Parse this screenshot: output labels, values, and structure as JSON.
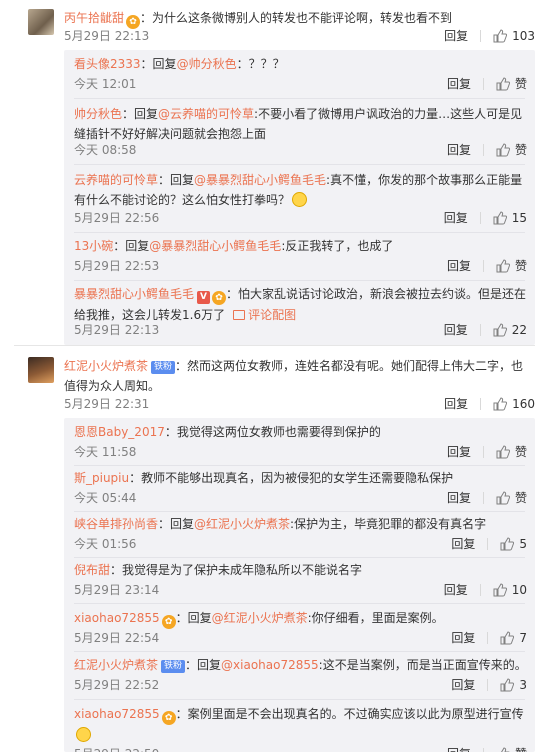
{
  "threads": [
    {
      "author": "丙午拾龇甜",
      "text": "：为什么这条微博别人的转发也不能评论啊，转发也看不到",
      "time": "5月29日 22:13",
      "reply": "回复",
      "likes": "103",
      "replies": [
        {
          "author": "看头像2333",
          "text": "：回复",
          "mention": "@帅分秋色",
          "rest": "：？？？",
          "time": "今天 12:01",
          "reply": "回复",
          "likes": "赞"
        },
        {
          "author": "帅分秋色",
          "text": "：回复",
          "mention": "@云养喵的可怜草",
          "rest": ":不要小看了微博用户讽政治的力量…这些人可是见缝插针不好好解决问题就会抱怨上面",
          "time": "今天 08:58",
          "reply": "回复",
          "likes": "赞"
        },
        {
          "author": "云养喵的可怜草",
          "text": "：回复",
          "mention": "@暴暴烈甜心小鳄鱼毛毛",
          "rest": ":真不懂，你发的那个故事那么正能量有什么不能讨论的？这么怕女性打拳吗？",
          "time": "5月29日 22:56",
          "reply": "回复",
          "likes": "15"
        },
        {
          "author": "13小碗",
          "text": "：回复",
          "mention": "@暴暴烈甜心小鳄鱼毛毛",
          "rest": ":反正我转了，也成了",
          "time": "5月29日 22:53",
          "reply": "回复",
          "likes": "赞"
        },
        {
          "author": "暴暴烈甜心小鳄鱼毛毛",
          "text": "：怕大家乱说话讨论政治，新浪会被拉去约谈。但是还在给我推，这会儿转发1.6万了",
          "pic_link": "评论配图",
          "time": "5月29日 22:13",
          "reply": "回复",
          "likes": "22"
        }
      ]
    },
    {
      "author": "红泥小火炉煮茶",
      "badge": "铁粉",
      "text": "：然而这两位女教师，连姓名都没有呢。她们配得上伟大二字，也值得为众人周知。",
      "time": "5月29日 22:31",
      "reply": "回复",
      "likes": "160",
      "replies": [
        {
          "author": "恩恩Baby_2017",
          "text": "：我觉得这两位女教师也需要得到保护的",
          "time": "今天 11:58",
          "reply": "回复",
          "likes": "赞"
        },
        {
          "author": "斯_piupiu",
          "text": "：教师不能够出现真名，因为被侵犯的女学生还需要隐私保护",
          "time": "今天 05:44",
          "reply": "回复",
          "likes": "赞"
        },
        {
          "author": "峡谷单排孙尚香",
          "text": "：回复",
          "mention": "@红泥小火炉煮茶",
          "rest": ":保护为主，毕竟犯罪的都没有真名字",
          "time": "今天 01:56",
          "reply": "回复",
          "likes": "5"
        },
        {
          "author": "倪布甜",
          "text": "：我觉得是为了保护未成年隐私所以不能说名字",
          "time": "5月29日 23:14",
          "reply": "回复",
          "likes": "10"
        },
        {
          "author": "xiaohao72855",
          "text": "：回复",
          "mention": "@红泥小火炉煮茶",
          "rest": ":你仔细看，里面是案例。",
          "time": "5月29日 22:54",
          "reply": "回复",
          "likes": "7"
        },
        {
          "author": "红泥小火炉煮茶",
          "badge": "铁粉",
          "text": "：回复",
          "mention": "@xiaohao72855",
          "rest": ":这不是当案例，而是当正面宣传来的。",
          "time": "5月29日 22:52",
          "reply": "回复",
          "likes": "3"
        },
        {
          "author": "xiaohao72855",
          "text": "：案例里面是不会出现真名的。不过确实应该以此为原型进行宣传",
          "time": "5月29日 22:50",
          "reply": "回复",
          "likes": "赞"
        }
      ]
    }
  ]
}
